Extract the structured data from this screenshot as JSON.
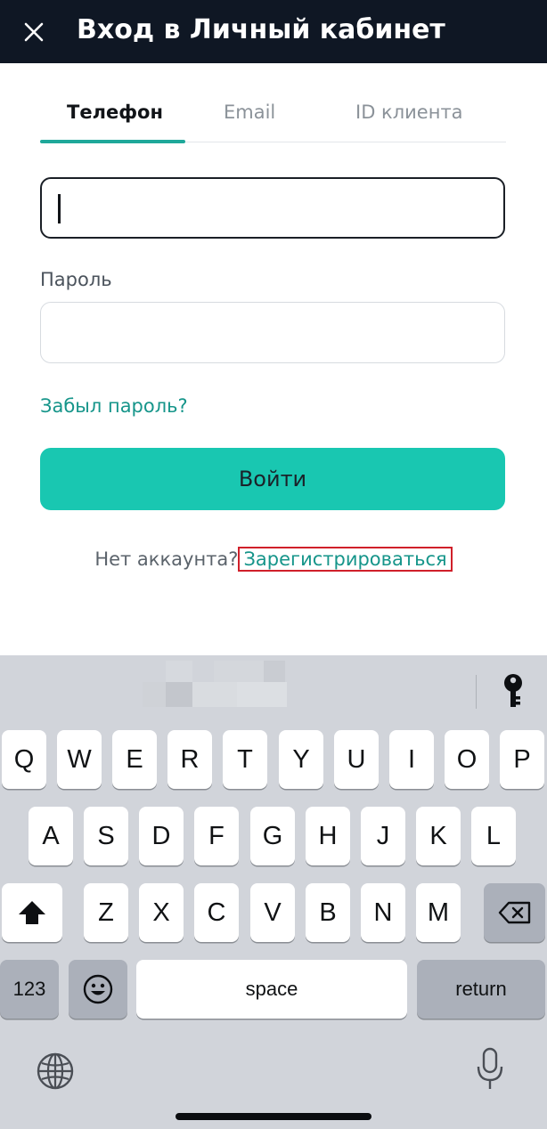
{
  "header": {
    "title": "Вход в Личный кабинет",
    "close_icon": "close-icon"
  },
  "tabs": [
    {
      "label": "Телефон",
      "active": true
    },
    {
      "label": "Email",
      "active": false
    },
    {
      "label": "ID клиента",
      "active": false
    }
  ],
  "form": {
    "phone_value": "",
    "password_label": "Пароль",
    "password_value": "",
    "forgot_label": "Забыл пароль?",
    "login_label": "Войти",
    "no_account_text": "Нет аккаунта?",
    "register_label": "Зарегистрироваться"
  },
  "colors": {
    "accent": "#19c7b1",
    "link": "#16958a",
    "header_bg": "#0f1724",
    "highlight_box": "#d0202a"
  },
  "keyboard": {
    "row1": [
      "Q",
      "W",
      "E",
      "R",
      "T",
      "Y",
      "U",
      "I",
      "O",
      "P"
    ],
    "row2": [
      "A",
      "S",
      "D",
      "F",
      "G",
      "H",
      "J",
      "K",
      "L"
    ],
    "row3": [
      "Z",
      "X",
      "C",
      "V",
      "B",
      "N",
      "M"
    ],
    "numbers_label": "123",
    "space_label": "space",
    "return_label": "return",
    "icons": [
      "key-icon",
      "shift-icon",
      "backspace-icon",
      "emoji-icon",
      "globe-icon",
      "microphone-icon"
    ]
  }
}
